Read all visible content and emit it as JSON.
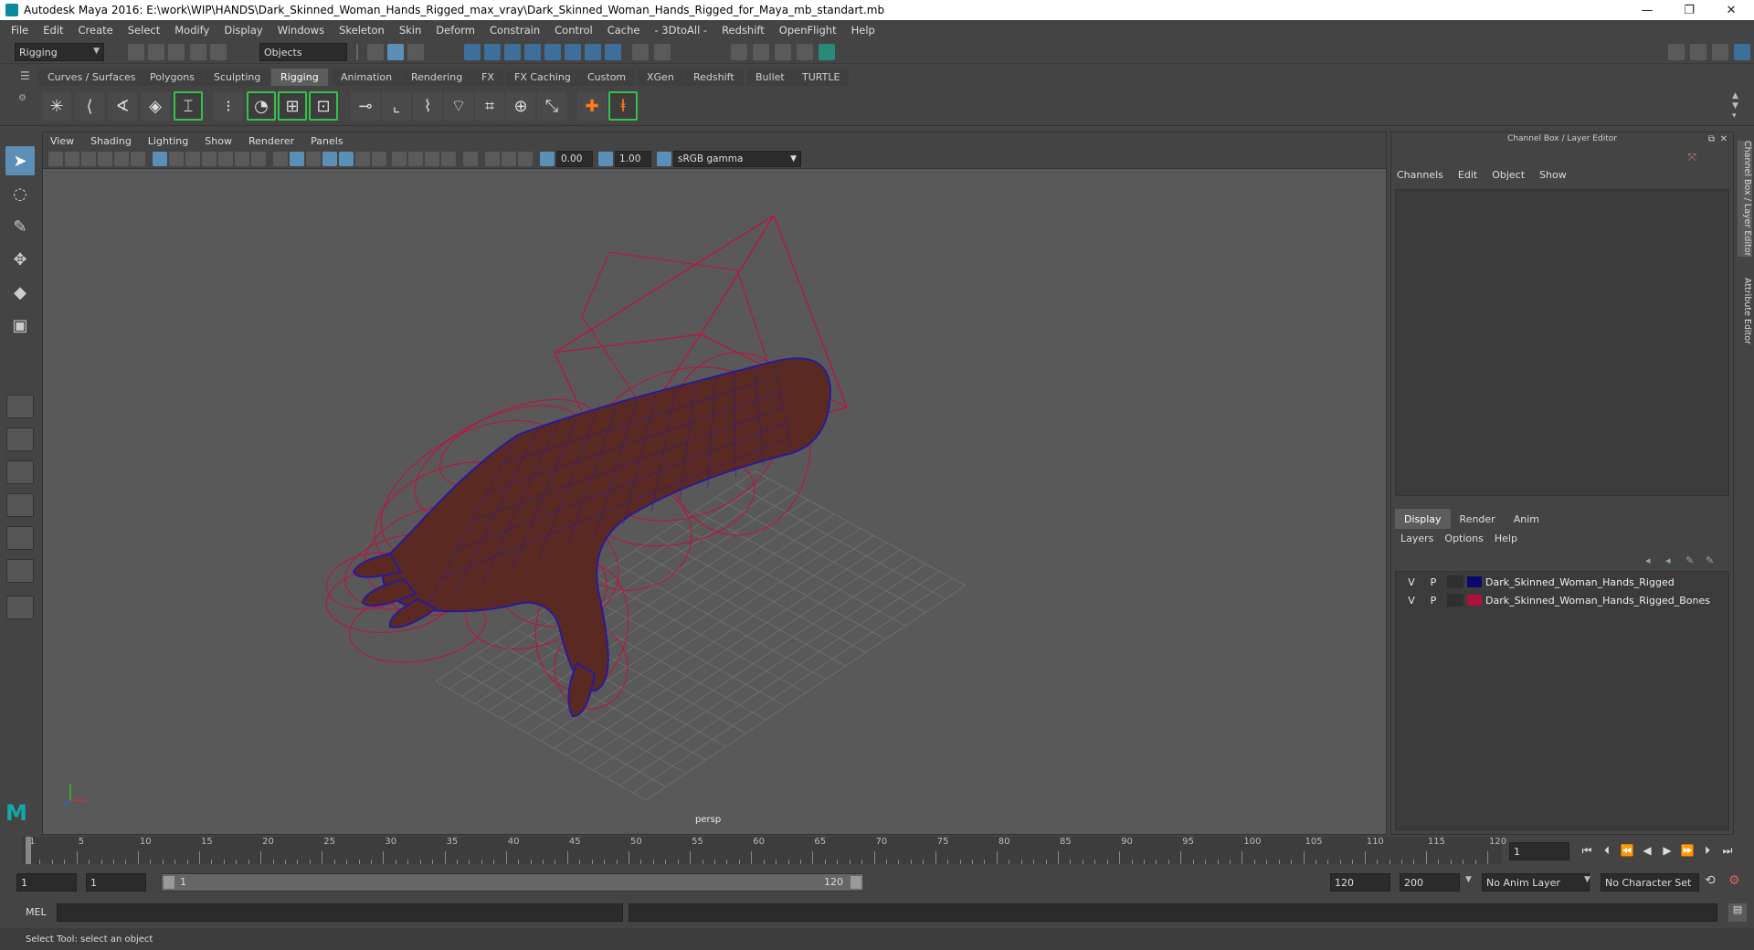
{
  "window": {
    "title": "Autodesk Maya 2016: E:\\work\\WIP\\HANDS\\Dark_Skinned_Woman_Hands_Rigged_max_vray\\Dark_Skinned_Woman_Hands_Rigged_for_Maya_mb_standart.mb",
    "minimize": "—",
    "restore": "❐",
    "close": "✕"
  },
  "menubar": [
    "File",
    "Edit",
    "Create",
    "Select",
    "Modify",
    "Display",
    "Windows",
    "Skeleton",
    "Skin",
    "Deform",
    "Constrain",
    "Control",
    "Cache",
    "- 3DtoAll -",
    "Redshift",
    "OpenFlight",
    "Help"
  ],
  "statusline": {
    "menuset": "Rigging",
    "selection_mode": "Objects"
  },
  "shelf_tabs": {
    "items": [
      "Curves / Surfaces",
      "Polygons",
      "Sculpting",
      "Rigging",
      "Animation",
      "Rendering",
      "FX",
      "FX Caching",
      "Custom",
      "XGen",
      "Redshift",
      "Bullet",
      "TURTLE"
    ],
    "active": "Rigging"
  },
  "panel": {
    "menus": [
      "View",
      "Shading",
      "Lighting",
      "Show",
      "Renderer",
      "Panels"
    ],
    "exposure": "0.00",
    "gamma": "1.00",
    "colorspace": "sRGB gamma",
    "camera": "persp"
  },
  "channel_box": {
    "title": "Channel Box / Layer Editor",
    "menus": [
      "Channels",
      "Edit",
      "Object",
      "Show"
    ]
  },
  "layer_editor": {
    "tabs": [
      "Display",
      "Render",
      "Anim"
    ],
    "active_tab": "Display",
    "menus": [
      "Layers",
      "Options",
      "Help"
    ],
    "layers": [
      {
        "v": "V",
        "p": "P",
        "color": "#0a0a6e",
        "name": "Dark_Skinned_Woman_Hands_Rigged"
      },
      {
        "v": "V",
        "p": "P",
        "color": "#b0103a",
        "name": "Dark_Skinned_Woman_Hands_Rigged_Bones"
      }
    ]
  },
  "side_tabs": [
    "Channel Box / Layer Editor",
    "Attribute Editor"
  ],
  "timeline": {
    "ticks": [
      "1",
      "5",
      "10",
      "15",
      "20",
      "25",
      "30",
      "35",
      "40",
      "45",
      "50",
      "55",
      "60",
      "65",
      "70",
      "75",
      "80",
      "85",
      "90",
      "95",
      "100",
      "105",
      "110",
      "115",
      "120"
    ],
    "current_frame": "1"
  },
  "range": {
    "start": "1",
    "playback_start": "1",
    "slider_start": "1",
    "slider_end": "120",
    "playback_end": "120",
    "end": "200",
    "anim_layer": "No Anim Layer",
    "character_set": "No Character Set"
  },
  "cmdline": {
    "label": "MEL"
  },
  "helpline": {
    "text": "Select Tool: select an object"
  },
  "colors": {
    "wireframe": "#c0103c",
    "mesh": "#5a2a22",
    "mesh_wire": "#2a1a9a",
    "grid": "#6e6e6e",
    "accent": "#5d8fb6"
  }
}
